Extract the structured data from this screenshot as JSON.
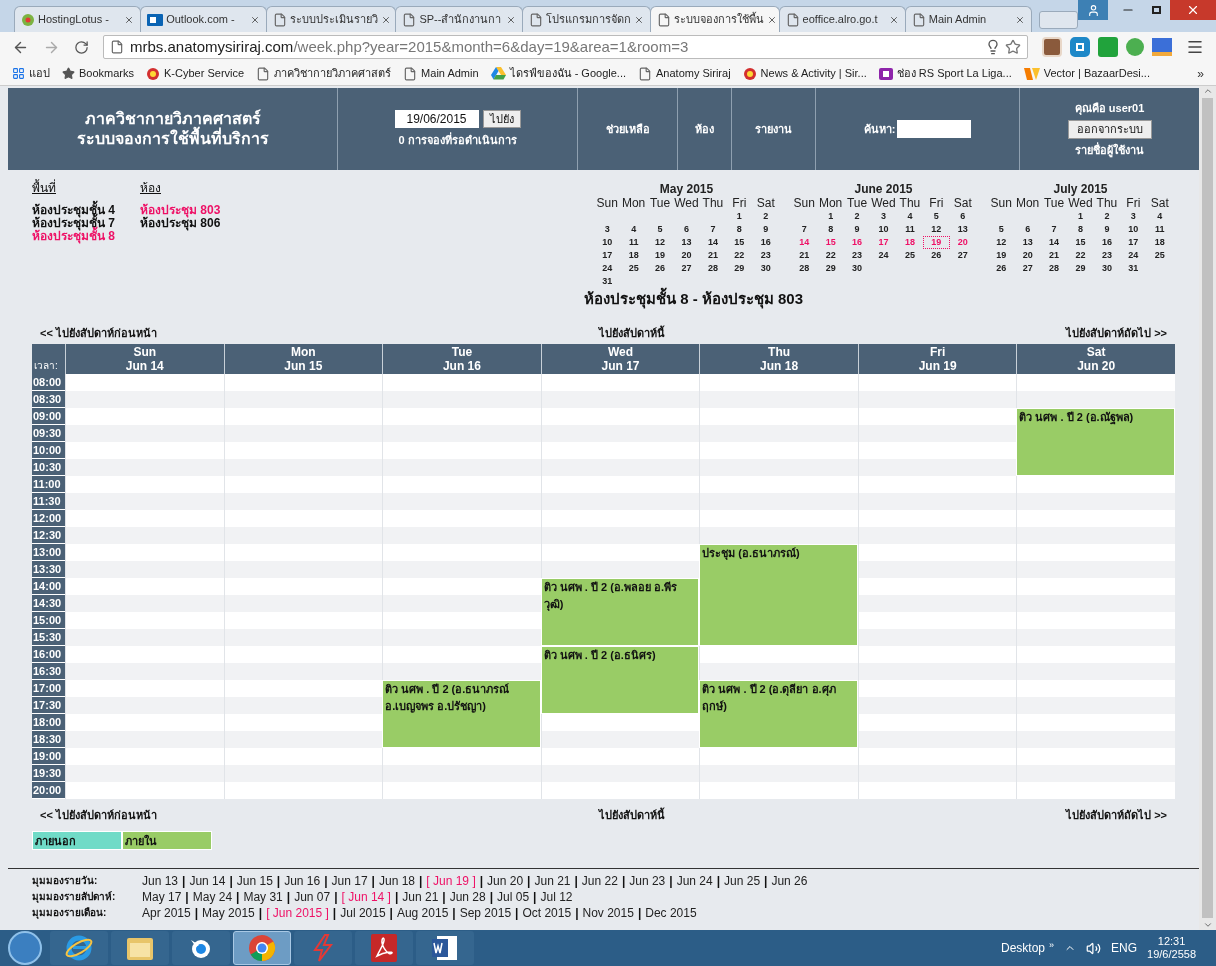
{
  "browser": {
    "tabs": [
      {
        "title": "HostingLotus -",
        "kind": "leaf",
        "selected": false
      },
      {
        "title": "Outlook.com -",
        "kind": "mail",
        "selected": false
      },
      {
        "title": "ระบบประเมินรายวิ",
        "kind": "page",
        "selected": false
      },
      {
        "title": "SP--สำนักงานกา",
        "kind": "page",
        "selected": false
      },
      {
        "title": "โปรแกรมการจัดก",
        "kind": "page",
        "selected": false
      },
      {
        "title": "ระบบจองการใช้พื้น",
        "kind": "page",
        "selected": true
      },
      {
        "title": "eoffice.alro.go.t",
        "kind": "page",
        "selected": false
      },
      {
        "title": "Main Admin",
        "kind": "page",
        "selected": false
      }
    ],
    "address": {
      "host": "mrbs.anatomysiriraj.com",
      "path": "/week.php?year=2015&month=6&day=19&area=1&room=3"
    },
    "bookmarks": [
      {
        "label": "แอป",
        "kind": "apps"
      },
      {
        "label": "Bookmarks",
        "kind": "star"
      },
      {
        "label": "K-Cyber Service",
        "kind": "circle"
      },
      {
        "label": "ภาควิชากายวิภาคศาสตร์",
        "kind": "page"
      },
      {
        "label": "Main Admin",
        "kind": "page"
      },
      {
        "label": "ไดรฟ์ของฉัน - Google...",
        "kind": "drive"
      },
      {
        "label": "Anatomy Siriraj",
        "kind": "page"
      },
      {
        "label": "News & Activity | Sir...",
        "kind": "circle"
      },
      {
        "label": "ช่อง RS Sport La Liga...",
        "kind": "tv"
      },
      {
        "label": "Vector | BazaarDesi...",
        "kind": "vector"
      }
    ],
    "bookmarks_more": "»"
  },
  "header": {
    "title_lines": [
      "ภาควิชากายวิภาคศาสตร์",
      "ระบบจองการใช้พื้นที่บริการ"
    ],
    "date_value": "19/06/2015",
    "goto_button": "ไปยัง",
    "pending": "0 การจองที่รอดำเนินการ",
    "nav": [
      "ช่วยเหลือ",
      "ห้อง",
      "รายงาน"
    ],
    "search_label": "ค้นหา:",
    "user": "คุณคือ user01",
    "logout_button": "ออกจากระบบ",
    "user_list": "รายชื่อผู้ใช้งาน"
  },
  "areas": {
    "heading": "พื้นที่",
    "items": [
      {
        "label": "ห้องประชุมชั้น 4",
        "selected": false
      },
      {
        "label": "ห้องประชุมชั้น 7",
        "selected": false
      },
      {
        "label": "ห้องประชุมชั้น 8",
        "selected": true
      }
    ]
  },
  "rooms": {
    "heading": "ห้อง",
    "items": [
      {
        "label": "ห้องประชุม 803",
        "selected": true
      },
      {
        "label": "ห้องประชุม 806",
        "selected": false
      }
    ]
  },
  "months": [
    {
      "title": "May 2015",
      "weekdays": [
        "Sun",
        "Mon",
        "Tue",
        "Wed",
        "Thu",
        "Fri",
        "Sat"
      ],
      "weeks": [
        {
          "days": [
            "1",
            "2"
          ],
          "selected": false
        },
        {
          "days": [
            "3",
            "4",
            "5",
            "6",
            "7",
            "8",
            "9"
          ],
          "selected": false
        },
        {
          "days": [
            "10",
            "11",
            "12",
            "13",
            "14",
            "15",
            "16"
          ],
          "selected": false
        },
        {
          "days": [
            "17",
            "18",
            "19",
            "20",
            "21",
            "22",
            "23"
          ],
          "selected": false
        },
        {
          "days": [
            "24",
            "25",
            "26",
            "27",
            "28",
            "29",
            "30"
          ],
          "selected": false
        },
        {
          "days": [
            "31"
          ],
          "selected": false
        }
      ]
    },
    {
      "title": "June 2015",
      "weekdays": [
        "Sun",
        "Mon",
        "Tue",
        "Wed",
        "Thu",
        "Fri",
        "Sat"
      ],
      "weeks": [
        {
          "days": [
            "1",
            "2",
            "3",
            "4",
            "5",
            "6"
          ],
          "selected": false
        },
        {
          "days": [
            "7",
            "8",
            "9",
            "10",
            "11",
            "12",
            "13"
          ],
          "selected": false
        },
        {
          "days": [
            {
              "n": "14",
              "today": false
            },
            {
              "n": "15",
              "today": false
            },
            {
              "n": "16",
              "today": false
            },
            {
              "n": "17",
              "today": false
            },
            {
              "n": "18",
              "today": false
            },
            {
              "n": "19",
              "today": true
            },
            {
              "n": "20",
              "today": false
            }
          ],
          "selected": true
        },
        {
          "days": [
            "21",
            "22",
            "23",
            "24",
            "25",
            "26",
            "27"
          ],
          "selected": false
        },
        {
          "days": [
            "28",
            "29",
            "30"
          ],
          "selected": false
        }
      ]
    },
    {
      "title": "July 2015",
      "weekdays": [
        "Sun",
        "Mon",
        "Tue",
        "Wed",
        "Thu",
        "Fri",
        "Sat"
      ],
      "weeks": [
        {
          "days": [
            "1",
            "2",
            "3",
            "4"
          ],
          "selected": false
        },
        {
          "days": [
            "5",
            "6",
            "7",
            "8",
            "9",
            "10",
            "11"
          ],
          "selected": false
        },
        {
          "days": [
            "12",
            "13",
            "14",
            "15",
            "16",
            "17",
            "18"
          ],
          "selected": false
        },
        {
          "days": [
            "19",
            "20",
            "21",
            "22",
            "23",
            "24",
            "25"
          ],
          "selected": false
        },
        {
          "days": [
            "26",
            "27",
            "28",
            "29",
            "30",
            "31"
          ],
          "selected": false
        }
      ]
    }
  ],
  "title": "ห้องประชุมชั้น 8 - ห้องประชุม 803",
  "week_nav_top": {
    "prev": "<< ไปยังสัปดาห์ก่อนหน้า",
    "current": "ไปยังสัปดาห์นี้",
    "next": "ไปยังสัปดาห์ถัดไป >>"
  },
  "week": {
    "time_label": "เวลา:",
    "days": [
      {
        "name": "Sun",
        "date": "Jun 14"
      },
      {
        "name": "Mon",
        "date": "Jun 15"
      },
      {
        "name": "Tue",
        "date": "Jun 16"
      },
      {
        "name": "Wed",
        "date": "Jun 17"
      },
      {
        "name": "Thu",
        "date": "Jun 18"
      },
      {
        "name": "Fri",
        "date": "Jun 19"
      },
      {
        "name": "Sat",
        "date": "Jun 20"
      }
    ],
    "rows": [
      {
        "time": "08:00",
        "cells": [
          {
            "kind": "free"
          },
          {
            "kind": "free"
          },
          {
            "kind": "free"
          },
          {
            "kind": "free"
          },
          {
            "kind": "free"
          },
          {
            "kind": "free"
          },
          {
            "kind": "free"
          }
        ]
      },
      {
        "time": "08:30",
        "cells": [
          {
            "kind": "free"
          },
          {
            "kind": "free"
          },
          {
            "kind": "free"
          },
          {
            "kind": "free"
          },
          {
            "kind": "free"
          },
          {
            "kind": "free"
          },
          {
            "kind": "free"
          }
        ]
      },
      {
        "time": "09:00",
        "cells": [
          {
            "kind": "free"
          },
          {
            "kind": "free"
          },
          {
            "kind": "free"
          },
          {
            "kind": "free"
          },
          {
            "kind": "free"
          },
          {
            "kind": "free"
          },
          {
            "kind": "booking",
            "text": "ติว นศพ . ปี 2 (อ.ณัฐพล)"
          }
        ]
      },
      {
        "time": "09:30",
        "cells": [
          {
            "kind": "free"
          },
          {
            "kind": "free"
          },
          {
            "kind": "free"
          },
          {
            "kind": "free"
          },
          {
            "kind": "free"
          },
          {
            "kind": "free"
          },
          {
            "kind": "booked"
          }
        ]
      },
      {
        "time": "10:00",
        "cells": [
          {
            "kind": "free"
          },
          {
            "kind": "free"
          },
          {
            "kind": "free"
          },
          {
            "kind": "free"
          },
          {
            "kind": "free"
          },
          {
            "kind": "free"
          },
          {
            "kind": "booked"
          }
        ]
      },
      {
        "time": "10:30",
        "cells": [
          {
            "kind": "free"
          },
          {
            "kind": "free"
          },
          {
            "kind": "free"
          },
          {
            "kind": "free"
          },
          {
            "kind": "free"
          },
          {
            "kind": "free"
          },
          {
            "kind": "booked"
          }
        ]
      },
      {
        "time": "11:00",
        "cells": [
          {
            "kind": "free"
          },
          {
            "kind": "free"
          },
          {
            "kind": "free"
          },
          {
            "kind": "free"
          },
          {
            "kind": "free"
          },
          {
            "kind": "free"
          },
          {
            "kind": "free"
          }
        ]
      },
      {
        "time": "11:30",
        "cells": [
          {
            "kind": "free"
          },
          {
            "kind": "free"
          },
          {
            "kind": "free"
          },
          {
            "kind": "free"
          },
          {
            "kind": "free"
          },
          {
            "kind": "free"
          },
          {
            "kind": "free"
          }
        ]
      },
      {
        "time": "12:00",
        "cells": [
          {
            "kind": "free"
          },
          {
            "kind": "free"
          },
          {
            "kind": "free"
          },
          {
            "kind": "free"
          },
          {
            "kind": "free"
          },
          {
            "kind": "free"
          },
          {
            "kind": "free"
          }
        ]
      },
      {
        "time": "12:30",
        "cells": [
          {
            "kind": "free"
          },
          {
            "kind": "free"
          },
          {
            "kind": "free"
          },
          {
            "kind": "free"
          },
          {
            "kind": "free"
          },
          {
            "kind": "free"
          },
          {
            "kind": "free"
          }
        ]
      },
      {
        "time": "13:00",
        "cells": [
          {
            "kind": "free"
          },
          {
            "kind": "free"
          },
          {
            "kind": "free"
          },
          {
            "kind": "free"
          },
          {
            "kind": "booking",
            "text": "ประชุม (อ.ธนาภรณ์)"
          },
          {
            "kind": "free"
          },
          {
            "kind": "free"
          }
        ]
      },
      {
        "time": "13:30",
        "cells": [
          {
            "kind": "free"
          },
          {
            "kind": "free"
          },
          {
            "kind": "free"
          },
          {
            "kind": "free"
          },
          {
            "kind": "booked"
          },
          {
            "kind": "free"
          },
          {
            "kind": "free"
          }
        ]
      },
      {
        "time": "14:00",
        "cells": [
          {
            "kind": "free"
          },
          {
            "kind": "free"
          },
          {
            "kind": "free"
          },
          {
            "kind": "booking",
            "text": "ติว นศพ . ปี 2 (อ.พลอย อ.พีรวุฒิ)"
          },
          {
            "kind": "booked"
          },
          {
            "kind": "free"
          },
          {
            "kind": "free"
          }
        ]
      },
      {
        "time": "14:30",
        "cells": [
          {
            "kind": "free"
          },
          {
            "kind": "free"
          },
          {
            "kind": "free"
          },
          {
            "kind": "booked"
          },
          {
            "kind": "booked"
          },
          {
            "kind": "free"
          },
          {
            "kind": "free"
          }
        ]
      },
      {
        "time": "15:00",
        "cells": [
          {
            "kind": "free"
          },
          {
            "kind": "free"
          },
          {
            "kind": "free"
          },
          {
            "kind": "booked"
          },
          {
            "kind": "booked"
          },
          {
            "kind": "free"
          },
          {
            "kind": "free"
          }
        ]
      },
      {
        "time": "15:30",
        "cells": [
          {
            "kind": "free"
          },
          {
            "kind": "free"
          },
          {
            "kind": "free"
          },
          {
            "kind": "booked"
          },
          {
            "kind": "booked"
          },
          {
            "kind": "free"
          },
          {
            "kind": "free"
          }
        ]
      },
      {
        "time": "16:00",
        "cells": [
          {
            "kind": "free"
          },
          {
            "kind": "free"
          },
          {
            "kind": "free"
          },
          {
            "kind": "booking",
            "text": "ติว นศพ . ปี 2 (อ.ธนิศร)"
          },
          {
            "kind": "free"
          },
          {
            "kind": "free"
          },
          {
            "kind": "free"
          }
        ]
      },
      {
        "time": "16:30",
        "cells": [
          {
            "kind": "free"
          },
          {
            "kind": "free"
          },
          {
            "kind": "free"
          },
          {
            "kind": "booked"
          },
          {
            "kind": "free"
          },
          {
            "kind": "free"
          },
          {
            "kind": "free"
          }
        ]
      },
      {
        "time": "17:00",
        "cells": [
          {
            "kind": "free"
          },
          {
            "kind": "free"
          },
          {
            "kind": "booking",
            "text": "ติว นศพ . ปี 2 (อ.ธนาภรณ์ อ.เบญจพร อ.ปรัชญา)"
          },
          {
            "kind": "booked"
          },
          {
            "kind": "booking",
            "text": "ติว นศพ . ปี 2 (อ.ดุลียา อ.ศุภฤกษ์)"
          },
          {
            "kind": "free"
          },
          {
            "kind": "free"
          }
        ]
      },
      {
        "time": "17:30",
        "cells": [
          {
            "kind": "free"
          },
          {
            "kind": "free"
          },
          {
            "kind": "booked"
          },
          {
            "kind": "booked"
          },
          {
            "kind": "booked"
          },
          {
            "kind": "free"
          },
          {
            "kind": "free"
          }
        ]
      },
      {
        "time": "18:00",
        "cells": [
          {
            "kind": "free"
          },
          {
            "kind": "free"
          },
          {
            "kind": "booked"
          },
          {
            "kind": "free"
          },
          {
            "kind": "booked"
          },
          {
            "kind": "free"
          },
          {
            "kind": "free"
          }
        ]
      },
      {
        "time": "18:30",
        "cells": [
          {
            "kind": "free"
          },
          {
            "kind": "free"
          },
          {
            "kind": "booked"
          },
          {
            "kind": "free"
          },
          {
            "kind": "booked"
          },
          {
            "kind": "free"
          },
          {
            "kind": "free"
          }
        ]
      },
      {
        "time": "19:00",
        "cells": [
          {
            "kind": "free"
          },
          {
            "kind": "free"
          },
          {
            "kind": "free"
          },
          {
            "kind": "free"
          },
          {
            "kind": "free"
          },
          {
            "kind": "free"
          },
          {
            "kind": "free"
          }
        ]
      },
      {
        "time": "19:30",
        "cells": [
          {
            "kind": "free"
          },
          {
            "kind": "free"
          },
          {
            "kind": "free"
          },
          {
            "kind": "free"
          },
          {
            "kind": "free"
          },
          {
            "kind": "free"
          },
          {
            "kind": "free"
          }
        ]
      },
      {
        "time": "20:00",
        "cells": [
          {
            "kind": "free"
          },
          {
            "kind": "free"
          },
          {
            "kind": "free"
          },
          {
            "kind": "free"
          },
          {
            "kind": "free"
          },
          {
            "kind": "free"
          },
          {
            "kind": "free"
          }
        ]
      }
    ]
  },
  "week_nav_bottom": {
    "prev": "<< ไปยังสัปดาห์ก่อนหน้า",
    "current": "ไปยังสัปดาห์นี้",
    "next": "ไปยังสัปดาห์ถัดไป >>"
  },
  "legend": [
    {
      "label": "ภายนอก",
      "color": "#70dbc7"
    },
    {
      "label": "ภายใน",
      "color": "#99cc66"
    }
  ],
  "views": [
    {
      "label": "มุมมองรายวัน:",
      "separator": "|",
      "items": [
        {
          "text": "Jun 13",
          "selected": false
        },
        {
          "text": "Jun 14",
          "selected": false
        },
        {
          "text": "Jun 15",
          "selected": false
        },
        {
          "text": "Jun 16",
          "selected": false
        },
        {
          "text": "Jun 17",
          "selected": false
        },
        {
          "text": "Jun 18",
          "selected": false
        },
        {
          "text": "[ Jun 19 ]",
          "selected": true
        },
        {
          "text": "Jun 20",
          "selected": false
        },
        {
          "text": "Jun 21",
          "selected": false
        },
        {
          "text": "Jun 22",
          "selected": false
        },
        {
          "text": "Jun 23",
          "selected": false
        },
        {
          "text": "Jun 24",
          "selected": false
        },
        {
          "text": "Jun 25",
          "selected": false
        },
        {
          "text": "Jun 26",
          "selected": false
        }
      ]
    },
    {
      "label": "มุมมองรายสัปดาห์:",
      "separator": "|",
      "items": [
        {
          "text": "May 17",
          "selected": false
        },
        {
          "text": "May 24",
          "selected": false
        },
        {
          "text": "May 31",
          "selected": false
        },
        {
          "text": "Jun 07",
          "selected": false
        },
        {
          "text": "[ Jun 14 ]",
          "selected": true
        },
        {
          "text": "Jun 21",
          "selected": false
        },
        {
          "text": "Jun 28",
          "selected": false
        },
        {
          "text": "Jul 05",
          "selected": false
        },
        {
          "text": "Jul 12",
          "selected": false
        }
      ]
    },
    {
      "label": "มุมมองรายเดือน:",
      "separator": "|",
      "items": [
        {
          "text": "Apr 2015",
          "selected": false
        },
        {
          "text": "May 2015",
          "selected": false
        },
        {
          "text": "[ Jun 2015 ]",
          "selected": true
        },
        {
          "text": "Jul 2015",
          "selected": false
        },
        {
          "text": "Aug 2015",
          "selected": false
        },
        {
          "text": "Sep 2015",
          "selected": false
        },
        {
          "text": "Oct 2015",
          "selected": false
        },
        {
          "text": "Nov 2015",
          "selected": false
        },
        {
          "text": "Dec 2015",
          "selected": false
        }
      ]
    }
  ],
  "taskbar": {
    "apps": [
      {
        "kind": "ie",
        "selected": false
      },
      {
        "kind": "folder",
        "selected": false
      },
      {
        "kind": "bird",
        "selected": false
      },
      {
        "kind": "chrome",
        "selected": true
      },
      {
        "kind": "flash",
        "selected": false
      },
      {
        "kind": "pdf",
        "selected": false
      },
      {
        "kind": "word",
        "selected": false
      }
    ],
    "desktop": "Desktop",
    "more": "»",
    "language": "ENG",
    "time": "12:31",
    "date": "19/6/2558"
  }
}
